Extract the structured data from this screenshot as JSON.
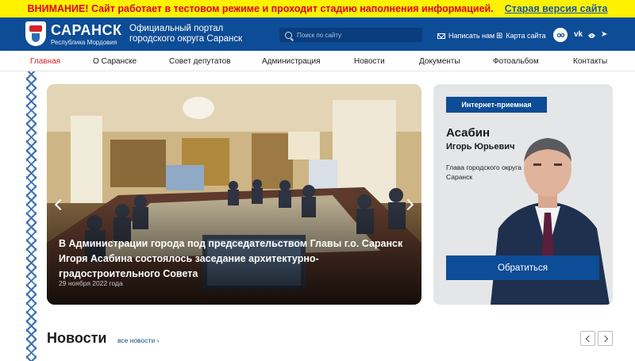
{
  "warning": {
    "text": "ВНИМАНИЕ! Сайт работает в тестовом режиме и проходит стадию наполнения информацией.",
    "old_site_link": "Старая версия сайта"
  },
  "header": {
    "logo_name": "САРАНСК",
    "logo_sub": "Республика Мордовия",
    "portal_line1": "Официальный портал",
    "portal_line2": "городского округа Саранск",
    "search_placeholder": "Поиск по сайту",
    "write_us": "Написать нам",
    "site_map": "Карта сайта",
    "accessibility_icon": "glasses-icon",
    "social": [
      "vk",
      "ok",
      "tg"
    ]
  },
  "menu": {
    "items": [
      "Главная",
      "О Саранске",
      "Совет депутатов",
      "Администрация",
      "Новости",
      "Документы",
      "Фотоальбом",
      "Контакты"
    ],
    "active": "Главная"
  },
  "slider": {
    "title": "В Администрации города под председательством Главы г.о. Саранск Игоря Асабина состоялось заседание архитектурно-градостроительного Совета",
    "date": "29 ноября 2022 года"
  },
  "mayor": {
    "badge": "Интернет-приемная",
    "surname": "Асабин",
    "name": "Игорь Юрьевич",
    "position": "Глава городского округа Саранск",
    "contact_button": "Обратиться"
  },
  "news": {
    "heading": "Новости",
    "all_link": "все новости ›"
  },
  "colors": {
    "brand_blue": "#0d4c96",
    "warning_yellow": "#fff200",
    "warning_red": "#e2001a",
    "menu_active": "#d2232a"
  }
}
